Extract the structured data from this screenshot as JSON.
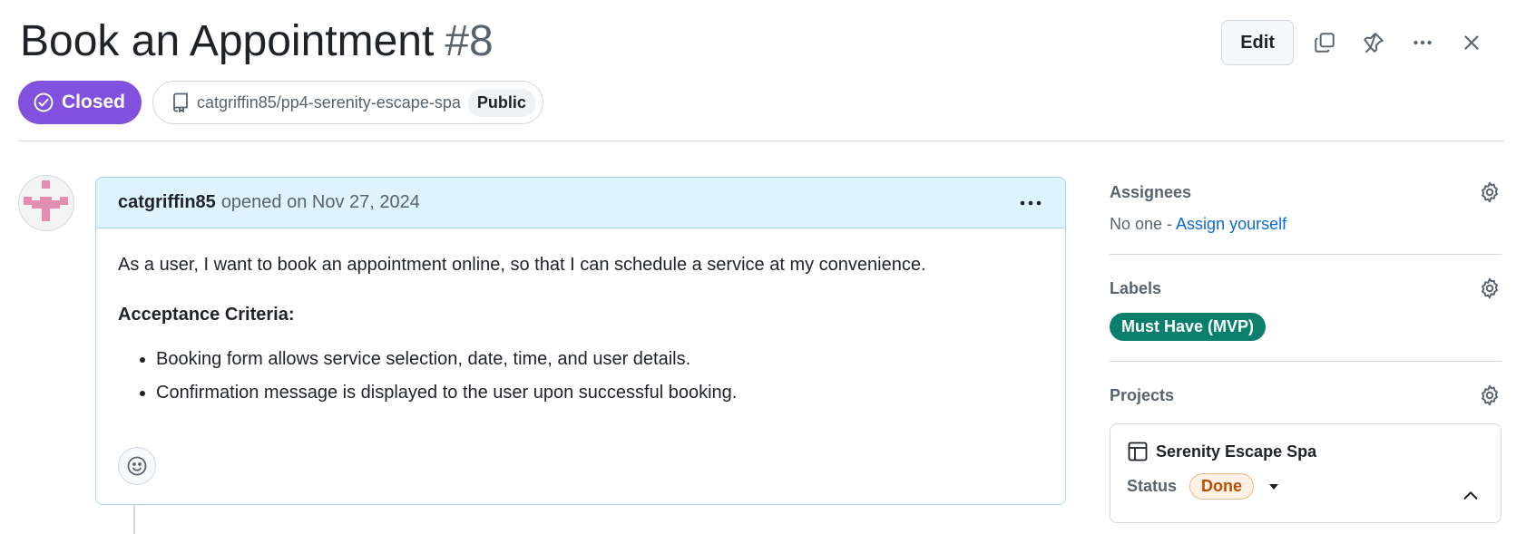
{
  "issue": {
    "title": "Book an Appointment",
    "number": "#8",
    "state": "Closed",
    "repo": "catgriffin85/pp4-serenity-escape-spa",
    "visibility": "Public"
  },
  "header_actions": {
    "edit_label": "Edit",
    "icons": [
      "copy-icon",
      "pin-icon",
      "kebab-horizontal-icon",
      "close-icon"
    ]
  },
  "comment": {
    "author": "catgriffin85",
    "opened_text": "opened on Nov 27, 2024",
    "body_intro": "As a user, I want to book an appointment online, so that I can schedule a service at my convenience.",
    "criteria_title": "Acceptance Criteria:",
    "criteria": [
      "Booking form allows service selection, date, time, and user details.",
      "Confirmation message is displayed to the user upon successful booking."
    ]
  },
  "sidebar": {
    "assignees": {
      "title": "Assignees",
      "none_text": "No one - ",
      "assign_link": "Assign yourself"
    },
    "labels": {
      "title": "Labels",
      "items": [
        {
          "name": "Must Have (MVP)",
          "color": "#0a7f6b"
        }
      ]
    },
    "projects": {
      "title": "Projects",
      "project_name": "Serenity Escape Spa",
      "status_label": "Status",
      "status_value": "Done"
    }
  },
  "colors": {
    "closed_state": "#8250df",
    "link": "#0969da",
    "comment_header_bg": "#ddf4ff",
    "status_done_text": "#bc4c00"
  }
}
